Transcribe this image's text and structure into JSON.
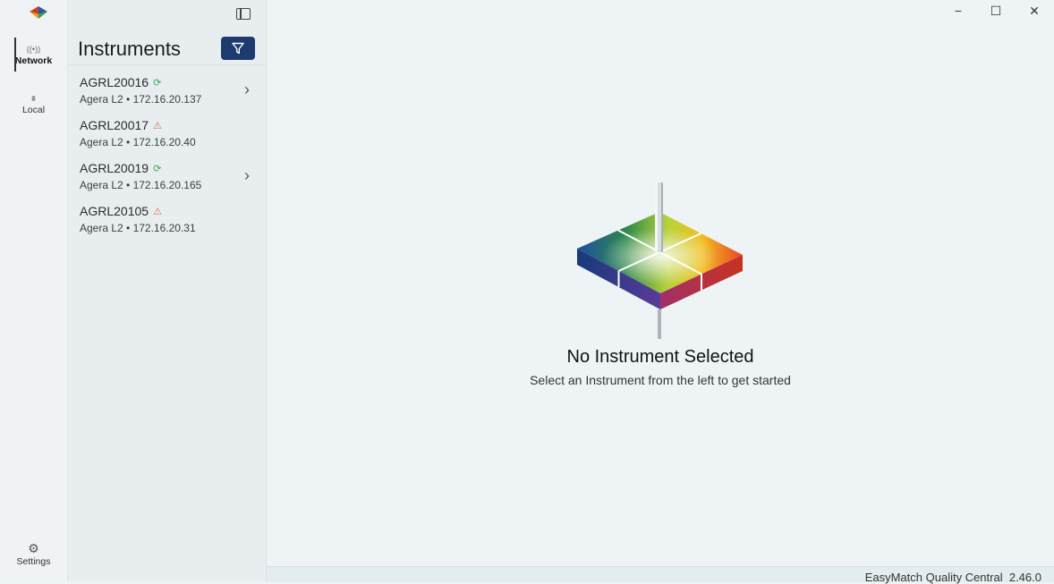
{
  "app": {
    "name": "EasyMatch Quality Central",
    "version": "2.46.0"
  },
  "rail": {
    "items": [
      {
        "label": "Network",
        "icon": "network-icon",
        "active": true
      },
      {
        "label": "Local",
        "icon": "local-icon",
        "active": false
      }
    ],
    "settings_label": "Settings"
  },
  "panel": {
    "title": "Instruments",
    "filter_icon": "filter-icon",
    "instruments": [
      {
        "name": "AGRL20016",
        "subtitle": "Agera L2 • 172.16.20.137",
        "status": "connected",
        "expandable": true
      },
      {
        "name": "AGRL20017",
        "subtitle": "Agera L2 • 172.16.20.40",
        "status": "warning",
        "expandable": false
      },
      {
        "name": "AGRL20019",
        "subtitle": "Agera L2 • 172.16.20.165",
        "status": "connected",
        "expandable": true
      },
      {
        "name": "AGRL20105",
        "subtitle": "Agera L2 • 172.16.20.31",
        "status": "warning",
        "expandable": false
      }
    ]
  },
  "main": {
    "empty_title": "No Instrument Selected",
    "empty_subtitle": "Select an Instrument from the left to get started"
  },
  "colors": {
    "accent": "#1e3a6e",
    "ok": "#3fa35a",
    "warn": "#e26a53"
  }
}
